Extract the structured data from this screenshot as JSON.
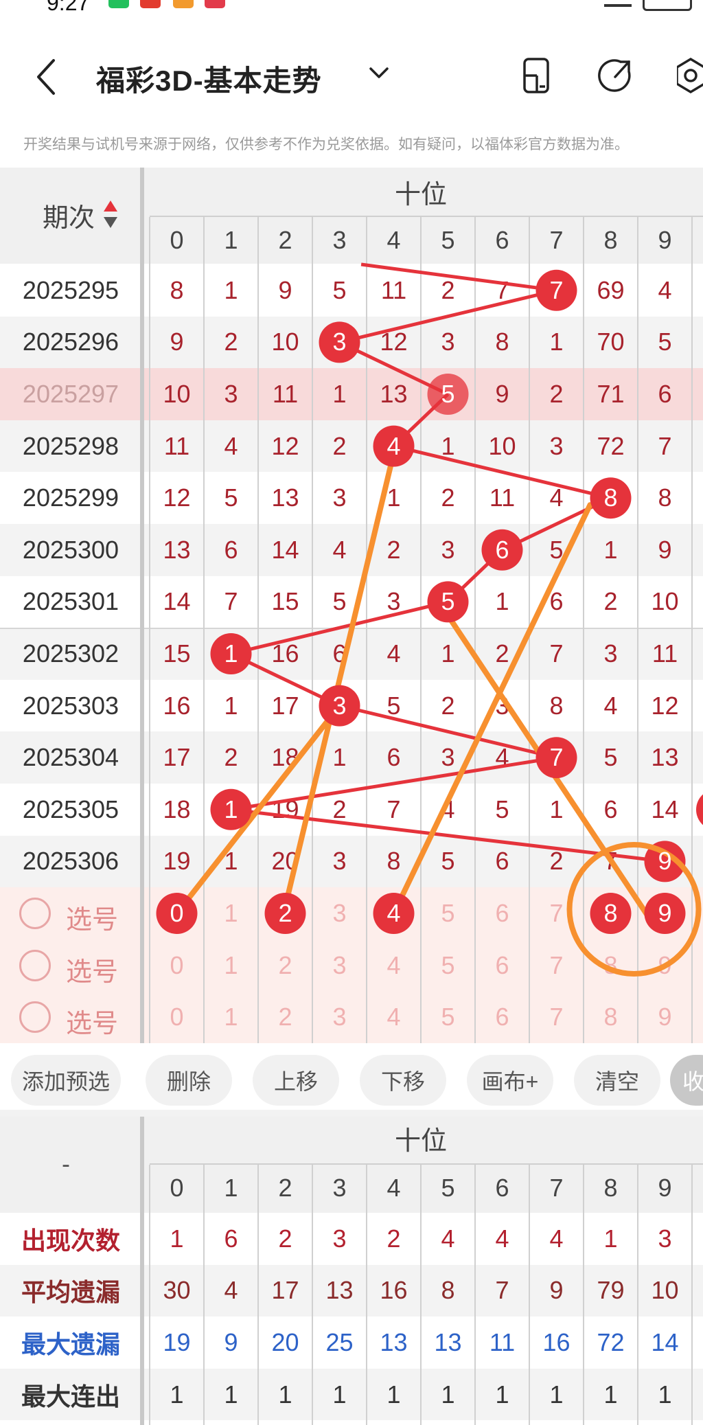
{
  "status_bar": {
    "time": "9:27"
  },
  "header": {
    "title": "福彩3D-基本走势"
  },
  "notice": "开奖结果与试机号来源于网络，仅供参考不作为兑奖依据。如有疑问，以福体彩官方数据为准。",
  "table": {
    "issue_header": "期次",
    "section_header": "十位",
    "digits": [
      "0",
      "1",
      "2",
      "3",
      "4",
      "5",
      "6",
      "7",
      "8",
      "9"
    ],
    "rows": [
      {
        "issue": "2025295",
        "cells": [
          "8",
          "1",
          "9",
          "5",
          "11",
          "2",
          "7",
          "7",
          "69",
          "4"
        ]
      },
      {
        "issue": "2025296",
        "cells": [
          "9",
          "2",
          "10",
          "3",
          "12",
          "3",
          "8",
          "1",
          "70",
          "5"
        ]
      },
      {
        "issue": "2025297",
        "cells": [
          "10",
          "3",
          "11",
          "1",
          "13",
          "5",
          "9",
          "2",
          "71",
          "6"
        ]
      },
      {
        "issue": "2025298",
        "cells": [
          "11",
          "4",
          "12",
          "2",
          "4",
          "1",
          "10",
          "3",
          "72",
          "7"
        ]
      },
      {
        "issue": "2025299",
        "cells": [
          "12",
          "5",
          "13",
          "3",
          "1",
          "2",
          "11",
          "4",
          "8",
          "8"
        ]
      },
      {
        "issue": "2025300",
        "cells": [
          "13",
          "6",
          "14",
          "4",
          "2",
          "3",
          "6",
          "5",
          "1",
          "9"
        ]
      },
      {
        "issue": "2025301",
        "cells": [
          "14",
          "7",
          "15",
          "5",
          "3",
          "5",
          "1",
          "6",
          "2",
          "10"
        ]
      },
      {
        "issue": "2025302",
        "cells": [
          "15",
          "1",
          "16",
          "6",
          "4",
          "1",
          "2",
          "7",
          "3",
          "11"
        ]
      },
      {
        "issue": "2025303",
        "cells": [
          "16",
          "1",
          "17",
          "3",
          "5",
          "2",
          "3",
          "8",
          "4",
          "12"
        ]
      },
      {
        "issue": "2025304",
        "cells": [
          "17",
          "2",
          "18",
          "1",
          "6",
          "3",
          "4",
          "7",
          "5",
          "13"
        ]
      },
      {
        "issue": "2025305",
        "cells": [
          "18",
          "1",
          "19",
          "2",
          "7",
          "4",
          "5",
          "1",
          "6",
          "14"
        ]
      },
      {
        "issue": "2025306",
        "cells": [
          "19",
          "1",
          "20",
          "3",
          "8",
          "5",
          "6",
          "2",
          "7",
          "9"
        ]
      }
    ],
    "ball_cols": [
      7,
      3,
      5,
      4,
      8,
      6,
      5,
      1,
      3,
      7,
      1,
      9
    ],
    "highlight_row": 2
  },
  "picks": {
    "label": "选号",
    "rows": [
      {
        "selected": [
          0,
          2,
          4,
          8,
          9
        ]
      },
      {
        "selected": []
      },
      {
        "selected": []
      }
    ]
  },
  "toolbar": {
    "buttons": [
      "添加预选",
      "删除",
      "上移",
      "下移",
      "画布+",
      "清空",
      "收"
    ]
  },
  "stats": {
    "corner": "-",
    "section_header": "十位",
    "rows": [
      {
        "label": "出现次数",
        "values": [
          "1",
          "6",
          "2",
          "3",
          "2",
          "4",
          "4",
          "4",
          "1",
          "3"
        ],
        "color": "#b3212f"
      },
      {
        "label": "平均遗漏",
        "values": [
          "30",
          "4",
          "17",
          "13",
          "16",
          "8",
          "7",
          "9",
          "79",
          "10"
        ],
        "color": "#8a2b2b"
      },
      {
        "label": "最大遗漏",
        "values": [
          "19",
          "9",
          "20",
          "25",
          "13",
          "13",
          "11",
          "16",
          "72",
          "14"
        ],
        "color": "#2d62c8"
      },
      {
        "label": "最大连出",
        "values": [
          "1",
          "1",
          "1",
          "1",
          "1",
          "1",
          "1",
          "1",
          "1",
          "1"
        ],
        "color": "#333333"
      }
    ]
  },
  "colors": {
    "ball_red": "#e5333b",
    "trend_line": "#e5333b",
    "draw_orange": "#f7902f",
    "number_red": "#a8222c",
    "highlight_row": "#f8dada",
    "pick_bg": "#fdeeeb"
  }
}
